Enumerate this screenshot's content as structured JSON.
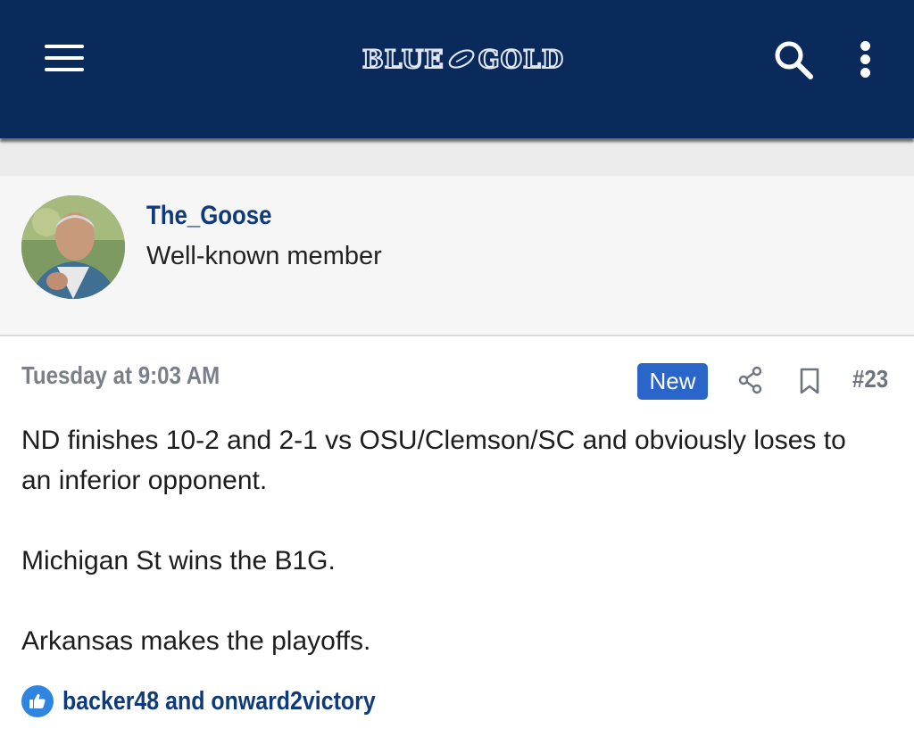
{
  "header": {
    "logo_left": "BLUE",
    "logo_right": "GOLD",
    "menu_icon": "hamburger-menu-icon",
    "search_icon": "search-icon",
    "more_icon": "vertical-ellipsis-icon",
    "bg_color": "#0b2a5c"
  },
  "author": {
    "username": "The_Goose",
    "title": "Well-known member"
  },
  "post": {
    "date": "Tuesday at 9:03 AM",
    "badge": "New",
    "badge_color": "#2a66c9",
    "number": "#23",
    "paragraphs": [
      "ND finishes 10-2 and 2-1 vs OSU/Clemson/SC and obviously loses to an inferior opponent.",
      "Michigan St wins the B1G.",
      "Arkansas makes the playoffs."
    ],
    "reactions_text": "backer48 and onward2victory",
    "reaction_icon": "thumbs-up-icon",
    "link_color": "#0f3b7a"
  }
}
